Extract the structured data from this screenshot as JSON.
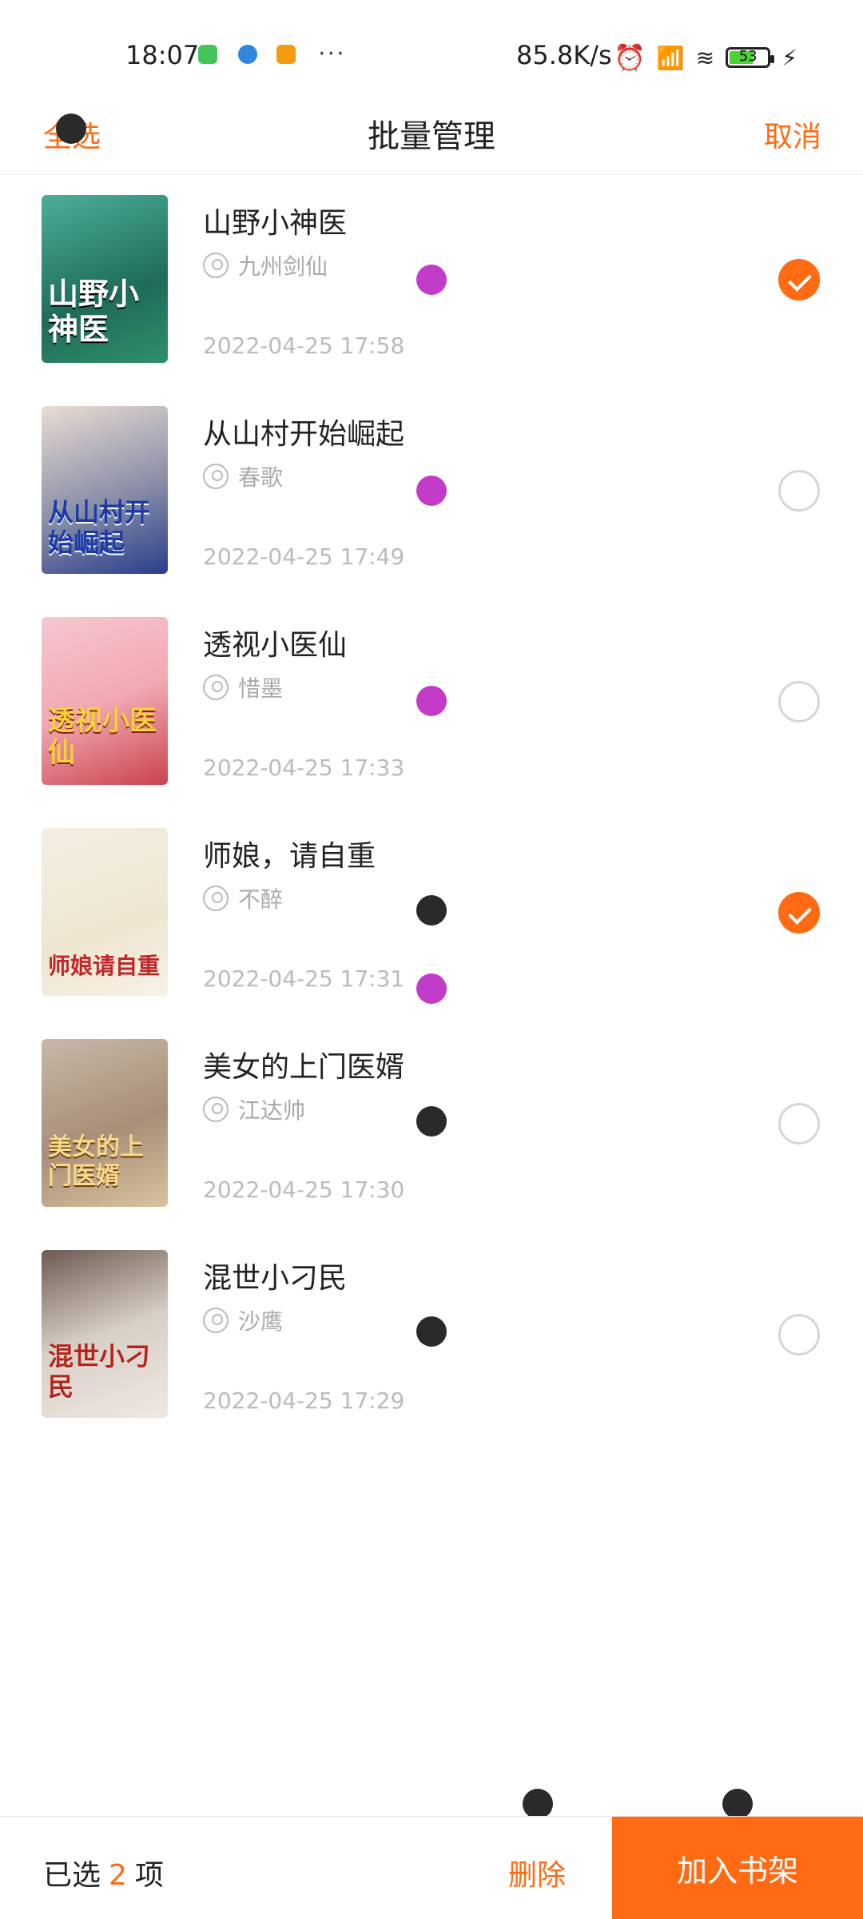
{
  "status_bar": {
    "time": "18:07",
    "net_speed": "85.8K/s",
    "battery": "53",
    "dots": "···"
  },
  "header": {
    "select_all": "全选",
    "title": "批量管理",
    "cancel": "取消"
  },
  "books": [
    {
      "title": "山野小神医",
      "author": "九州剑仙",
      "time": "2022-04-25 17:58",
      "checked": true,
      "cover_text": "山野小神医"
    },
    {
      "title": "从山村开始崛起",
      "author": "春歌",
      "time": "2022-04-25 17:49",
      "checked": false,
      "cover_text": "从山村开始崛起"
    },
    {
      "title": "透视小医仙",
      "author": "惜墨",
      "time": "2022-04-25 17:33",
      "checked": false,
      "cover_text": "透视小医仙"
    },
    {
      "title": "师娘，请自重",
      "author": "不醉",
      "time": "2022-04-25 17:31",
      "checked": true,
      "cover_text": "师娘请自重"
    },
    {
      "title": "美女的上门医婿",
      "author": "江达帅",
      "time": "2022-04-25 17:30",
      "checked": false,
      "cover_text": "美女的上门医婿"
    },
    {
      "title": "混世小刁民",
      "author": "沙鹰",
      "time": "2022-04-25 17:29",
      "checked": false,
      "cover_text": "混世小刁民"
    }
  ],
  "bottom": {
    "selected_prefix": "已选",
    "selected_count": "2",
    "selected_suffix": "项",
    "delete": "删除",
    "add_to_shelf": "加入书架"
  },
  "colors": {
    "accent": "#ff6a13"
  }
}
